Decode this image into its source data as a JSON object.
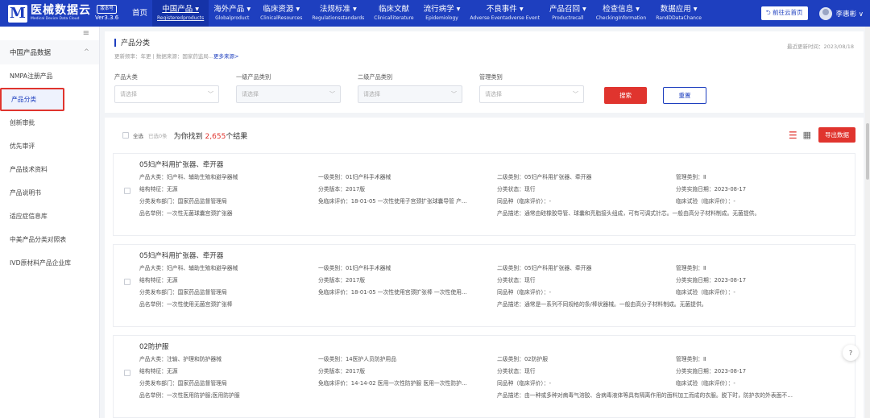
{
  "header": {
    "logo_mark": "M",
    "logo_title": "医械数据云",
    "logo_sub": "Medical Device Data Cloud",
    "version_badge": "版本号",
    "version": "Ver3.3.6",
    "nav": [
      {
        "cn": "首页",
        "en": ""
      },
      {
        "cn": "中国产品 ▾",
        "en": "Registeredproducts"
      },
      {
        "cn": "海外产品 ▾",
        "en": "Globalproduct"
      },
      {
        "cn": "临床资源 ▾",
        "en": "ClinicalResources"
      },
      {
        "cn": "法规标准 ▾",
        "en": "Regulationsstandards"
      },
      {
        "cn": "临床文献",
        "en": "Clinicalliterature"
      },
      {
        "cn": "流行病学 ▾",
        "en": "Epidemiology"
      },
      {
        "cn": "不良事件 ▾",
        "en": "Adverse Eventadverse Event"
      },
      {
        "cn": "产品召回 ▾",
        "en": "Productrecall"
      },
      {
        "cn": "检查信息 ▾",
        "en": "CheckingInformation"
      },
      {
        "cn": "数据应用 ▾",
        "en": "RandDDataChance"
      }
    ],
    "goto_label": "⮌ 前往云首页",
    "user_name": "李惠彬 ∨"
  },
  "sidebar": {
    "toggle": "≡",
    "group": "中国产品数据",
    "group_chevron": "^",
    "items": [
      {
        "label": "NMPA注册产品"
      },
      {
        "label": "产品分类"
      },
      {
        "label": "创新审批"
      },
      {
        "label": "优先审评"
      },
      {
        "label": "产品技术资料"
      },
      {
        "label": "产品说明书"
      },
      {
        "label": "适应症信息库"
      },
      {
        "label": "中美产品分类对照表"
      },
      {
        "label": "IVD原材料产品企业库"
      }
    ]
  },
  "filter": {
    "title": "产品分类",
    "update_info": "更新频率：年更 | 数据来源：国家药监局...",
    "more": "更多来源>",
    "update_time": "最近更新时间：2023/08/18",
    "fields": [
      {
        "label": "产品大类",
        "placeholder": "请选择"
      },
      {
        "label": "一级产品类别",
        "placeholder": "请选择"
      },
      {
        "label": "二级产品类别",
        "placeholder": "请选择"
      },
      {
        "label": "管理类别",
        "placeholder": "请选择"
      }
    ],
    "search_label": "搜索",
    "reset_label": "重置"
  },
  "results": {
    "select_all": "全选",
    "selected": "已选0条",
    "found_prefix": "为你找到",
    "found_count": "2,655",
    "found_suffix": "个结果",
    "export_label": "导出数据",
    "items": [
      {
        "title": "05妇产科用扩张器、牵开器",
        "c1": "产品大类：妇产科、辅助生殖和避孕器械",
        "c2": "一级类别：01妇产科手术器械",
        "c3": "二级类别：05妇产科用扩张器、牵开器",
        "c4": "管理类别：Ⅱ",
        "c5": "结构特征：无源",
        "c6": "分类版本：2017版",
        "c7": "分类状态：现行",
        "c8": "分类实施日期：2023-08-17",
        "c9": "分类发布部门：国家药品监督管理局",
        "c10": "免临床评价：18-01-05 一次性使用子宫颈扩张球囊导管 产…",
        "c11": "同品种（临床评价）：-",
        "c12": "临床试验（临床评价）：-",
        "c13": "品名举例：一次性无菌球囊宫颈扩张器",
        "c14": "产品描述：通常由硅橡胶导管、球囊和亮脂接头组成，可有可调式针芯。一般由高分子材料制成。无菌提供。"
      },
      {
        "title": "05妇产科用扩张器、牵开器",
        "c1": "产品大类：妇产科、辅助生殖和避孕器械",
        "c2": "一级类别：01妇产科手术器械",
        "c3": "二级类别：05妇产科用扩张器、牵开器",
        "c4": "管理类别：Ⅱ",
        "c5": "结构特征：无源",
        "c6": "分类版本：2017版",
        "c7": "分类状态：现行",
        "c8": "分类实施日期：2023-08-17",
        "c9": "分类发布部门：国家药品监督管理局",
        "c10": "免临床评价：18-01-05 一次性使用宫颈扩张棒 一次性使用…",
        "c11": "同品种（临床评价）：-",
        "c12": "临床试验（临床评价）：-",
        "c13": "品名举例：一次性使用无菌宫颈扩张棒",
        "c14": "产品描述：通常是一系列不同规格的条/棒状器械。一般由高分子材料制成。无菌提供。"
      },
      {
        "title": "02防护服",
        "c1": "产品大类：注输、护理和防护器械",
        "c2": "一级类别：14医护人员防护用品",
        "c3": "二级类别：02防护服",
        "c4": "管理类别：Ⅱ",
        "c5": "结构特征：无源",
        "c6": "分类版本：2017版",
        "c7": "分类状态：现行",
        "c8": "分类实施日期：2023-08-17",
        "c9": "分类发布部门：国家药品监督管理局",
        "c10": "免临床评价：14-14-02 医用一次性防护服 医用一次性防护…",
        "c11": "同品种（临床评价）：-",
        "c12": "临床试验（临床评价）：-",
        "c13": "品名举例：一次性医用防护服;医用防护服",
        "c14": "产品描述：由一种或多种对病毒气溶胶、含病毒液体等具有隔离作用的面料加工而成的衣服。脱下时，防护衣的外表面不…"
      }
    ]
  },
  "help_icon": "?",
  "colors": {
    "brand": "#1e3fbf",
    "accent": "#e0342e"
  }
}
